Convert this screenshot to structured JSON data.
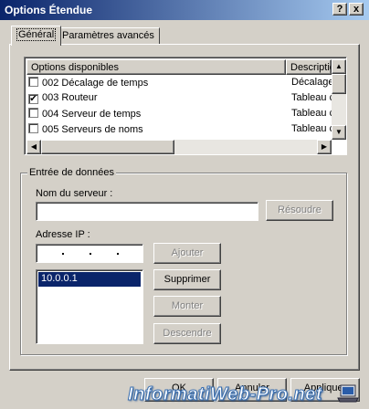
{
  "window": {
    "title": "Options Étendue",
    "help_label": "?",
    "close_label": "x"
  },
  "tabs": [
    {
      "label": "Général",
      "active": true
    },
    {
      "label": "Paramètres avancés",
      "active": false
    }
  ],
  "options_list": {
    "columns": [
      "Options disponibles",
      "Descriptio"
    ],
    "rows": [
      {
        "label": "002 Décalage de temps",
        "checked": false,
        "description": "Décalage"
      },
      {
        "label": "003 Routeur",
        "checked": true,
        "description": "Tableau c"
      },
      {
        "label": "004 Serveur de temps",
        "checked": false,
        "description": "Tableau c"
      },
      {
        "label": "005 Serveurs de noms",
        "checked": false,
        "description": "Tableau c"
      }
    ]
  },
  "data_entry": {
    "group_label": "Entrée de données",
    "server_name_label": "Nom du serveur :",
    "server_name_value": "",
    "resolve_button": "Résoudre",
    "ip_label": "Adresse IP :",
    "add_button": "Ajouter",
    "remove_button": "Supprimer",
    "up_button": "Monter",
    "down_button": "Descendre",
    "ip_entries": [
      "10.0.0.1"
    ]
  },
  "footer": {
    "ok_button": "OK",
    "cancel_button": "Annuler",
    "apply_button": "Appliquer",
    "watermark": "InformatiWeb-Pro.net"
  },
  "colors": {
    "title_start": "#0a246a",
    "title_end": "#a6caf0",
    "selection": "#0a246a",
    "face": "#d4d0c8"
  }
}
